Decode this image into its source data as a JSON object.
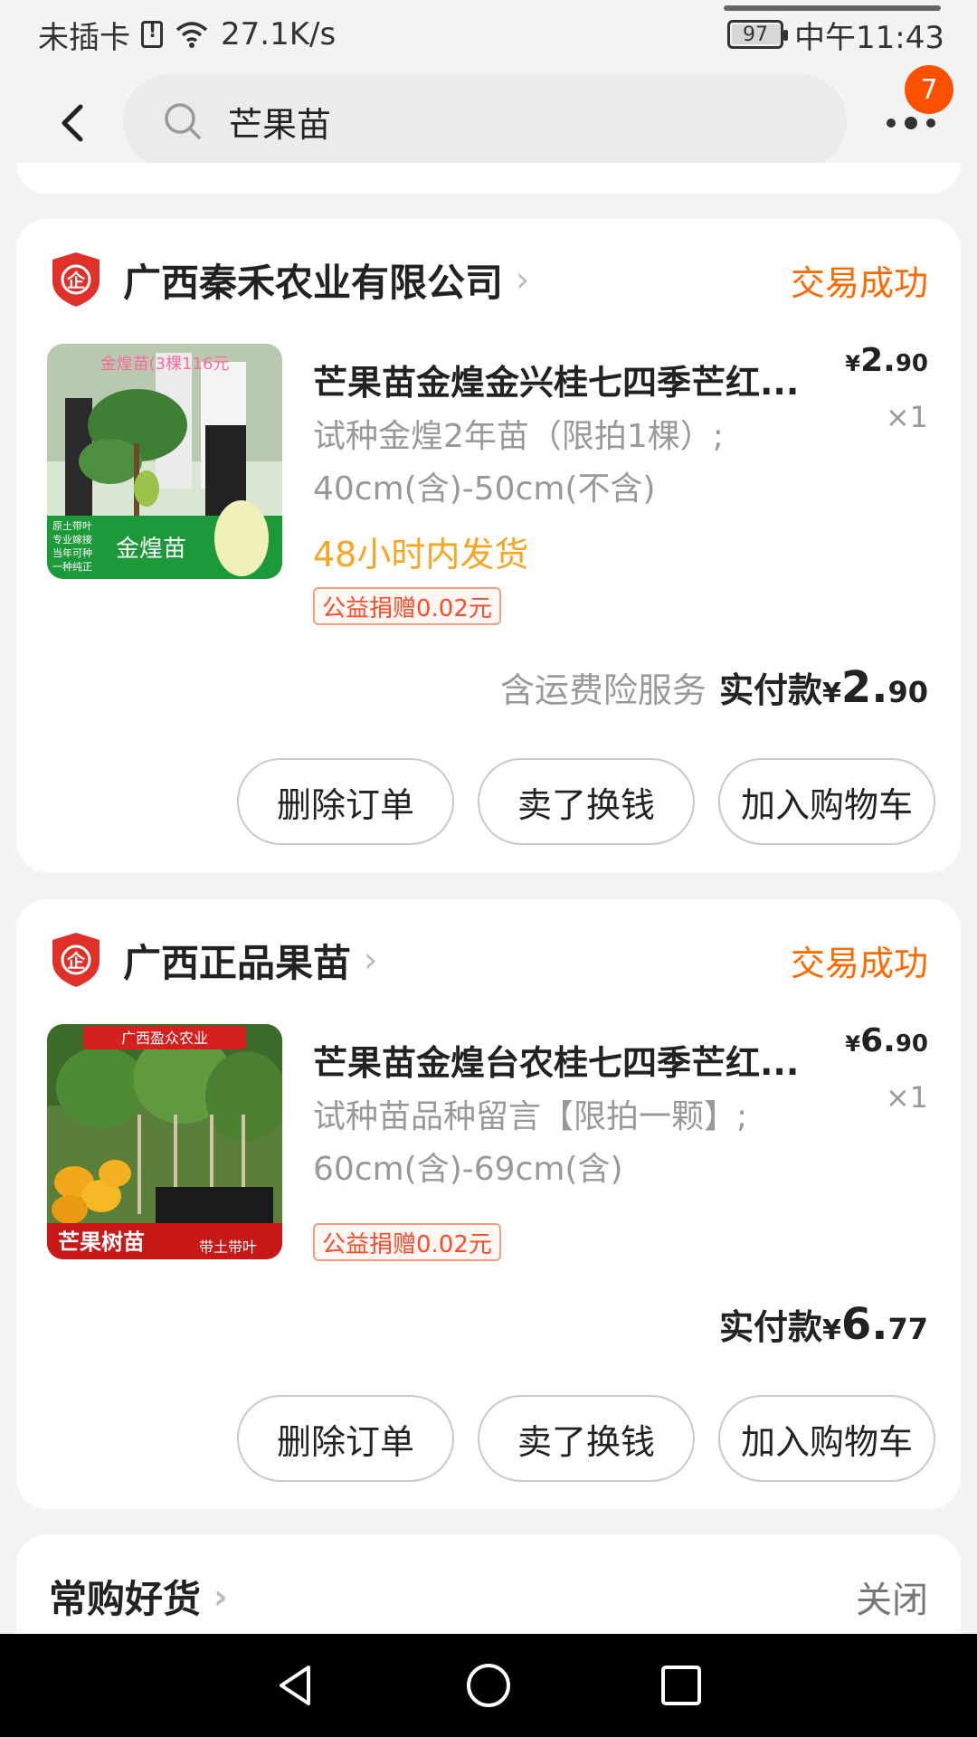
{
  "status_bar": {
    "carrier": "未插卡",
    "speed": "27.1K/s",
    "battery": "97",
    "time": "中午11:43"
  },
  "header": {
    "search_query": "芒果苗",
    "notification_count": "7"
  },
  "orders": [
    {
      "shop_name": "广西秦禾农业有限公司",
      "status": "交易成功",
      "product": {
        "title": "芒果苗金煌金兴桂七四季芒红...",
        "spec_line1": "试种金煌2年苗（限拍1棵）;",
        "spec_line2": "40cm(含)-50cm(不含)",
        "shipping": "48小时内发货",
        "charity": "公益捐赠0.02元",
        "price_yen": "¥",
        "price_int": "2.",
        "price_cents": "90",
        "quantity": "×1",
        "image_text_top": "金煌苗(3棵116元",
        "image_text_bottom": "金煌苗",
        "image_side_text": "原土带叶 专业嫁接 当年可种 一种纯正"
      },
      "paid_note": "含运费险服务",
      "paid_label": "实付款",
      "paid_yen": "¥",
      "paid_int": "2.",
      "paid_cents": "90",
      "buttons": [
        "删除订单",
        "卖了换钱",
        "加入购物车"
      ]
    },
    {
      "shop_name": "广西正品果苗",
      "status": "交易成功",
      "product": {
        "title": "芒果苗金煌台农桂七四季芒红...",
        "spec_line1": "试种苗品种留言【限拍一颗】;",
        "spec_line2": "60cm(含)-69cm(含)",
        "charity": "公益捐赠0.02元",
        "price_yen": "¥",
        "price_int": "6.",
        "price_cents": "90",
        "quantity": "×1",
        "image_text_top": "广西盈众农业",
        "image_text_bottom": "芒果树苗",
        "image_side_text": "带土带叶"
      },
      "paid_label": "实付款",
      "paid_yen": "¥",
      "paid_int": "6.",
      "paid_cents": "77",
      "buttons": [
        "删除订单",
        "卖了换钱",
        "加入购物车"
      ]
    }
  ],
  "recommend": {
    "title": "常购好货",
    "close": "关闭"
  },
  "colors": {
    "accent_orange": "#ff6a00",
    "badge": "#ff5000",
    "shipping_yellow": "#f5a623",
    "shop_logo_red": "#e0302a"
  }
}
